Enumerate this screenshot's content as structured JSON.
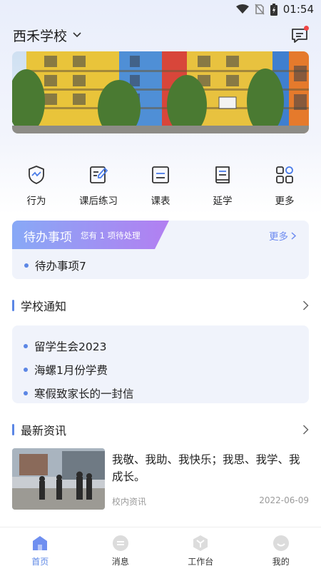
{
  "status_bar": {
    "time": "01:54",
    "icons": [
      "wifi-icon",
      "no-sim-icon",
      "battery-charging-icon"
    ]
  },
  "header": {
    "school_name": "西禾学校",
    "message_icon": "message-icon",
    "has_unread": true
  },
  "banner": {
    "description_icon": "campus-banner-image"
  },
  "quick_nav": [
    {
      "label": "行为",
      "icon": "behavior-shield-icon"
    },
    {
      "label": "课后练习",
      "icon": "homework-edit-icon"
    },
    {
      "label": "课表",
      "icon": "schedule-icon"
    },
    {
      "label": "延学",
      "icon": "book-icon"
    },
    {
      "label": "更多",
      "icon": "grid-more-icon"
    }
  ],
  "todo": {
    "title": "待办事项",
    "subtitle": "您有 1 项待处理",
    "more_label": "更多",
    "items": [
      "待办事项7"
    ]
  },
  "notices": {
    "title": "学校通知",
    "items": [
      "留学生会2023",
      "海螺1月份学费",
      "寒假致家长的一封信"
    ]
  },
  "news": {
    "title": "最新资讯",
    "items": [
      {
        "title": "我敬、我助、我快乐；我思、我学、我成长。",
        "source": "校内资讯",
        "date": "2022-06-09"
      }
    ]
  },
  "tab_bar": [
    {
      "label": "首页",
      "icon": "home-icon",
      "active": true
    },
    {
      "label": "消息",
      "icon": "message-bubble-icon",
      "active": false
    },
    {
      "label": "工作台",
      "icon": "workbench-icon",
      "active": false
    },
    {
      "label": "我的",
      "icon": "profile-icon",
      "active": false
    }
  ],
  "colors": {
    "accent": "#5b86e5",
    "todo_gradient_start": "#8aa8f5",
    "todo_gradient_end": "#b47cf0",
    "more_link": "#6d8bf0"
  }
}
